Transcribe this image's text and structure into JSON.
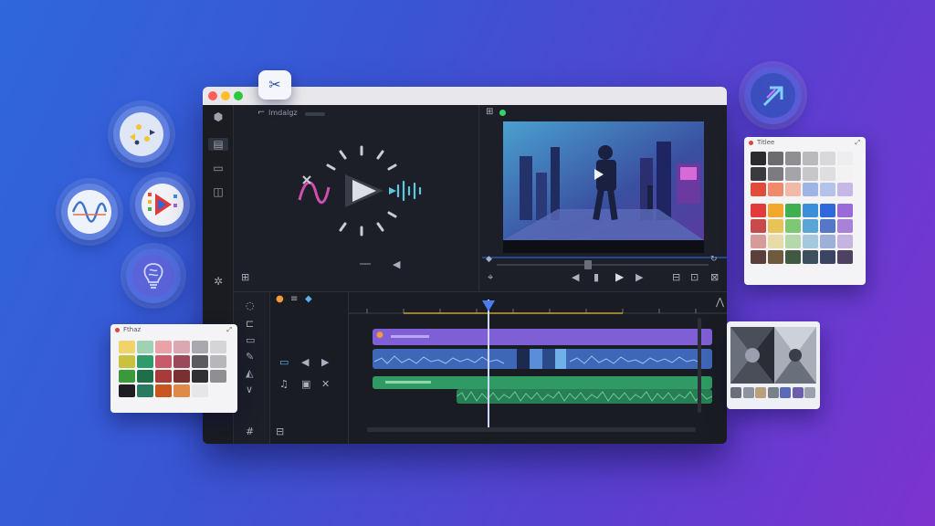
{
  "toolbar": {
    "pin_icon": "pin-icon"
  },
  "media_panel": {
    "tab_label": "Imdalgz"
  },
  "palette_right": {
    "title": "Titlee"
  },
  "palette_left": {
    "title": "Fthaz"
  },
  "colors": {
    "accent_purple": "#8a63e0",
    "accent_blue": "#3f73c8",
    "accent_green": "#3fb07a",
    "playhead": "#4a7df0",
    "status_green": "#3ad06b"
  },
  "palette_right_swatches": [
    [
      "#2b2b2e",
      "#6b6b70",
      "#8e8e93",
      "#b9b9be",
      "#d9d9dc",
      "#eeeeef"
    ],
    [
      "#3b3b3f",
      "#7c7c80",
      "#a5a5a9",
      "#c7c7ca",
      "#dedee0",
      "#f2f2f3"
    ],
    [
      "#e04b3a",
      "#f08a6c",
      "#f3b9a8",
      "#9db4e4",
      "#b3c3ea",
      "#c6b8e6"
    ],
    [
      "#e23a3a",
      "#f2a92b",
      "#3fb04d",
      "#3a8fd8",
      "#2f67dc",
      "#9a6ad8"
    ],
    [
      "#c84a4a",
      "#e8c35a",
      "#7fc873",
      "#5aa5d6",
      "#5577c8",
      "#a882d8"
    ],
    [
      "#d69a9a",
      "#e7dba8",
      "#b4d8a9",
      "#a6c8df",
      "#9fb0d8",
      "#c4b4df"
    ],
    [
      "#5a3f3b",
      "#6e5b3b",
      "#3f5a41",
      "#3c4f5e",
      "#3a4463",
      "#4e4260"
    ]
  ],
  "palette_left_swatches": [
    [
      "#f0d36a",
      "#9fd1b4",
      "#e9a2a8",
      "#d9a8b3",
      "#a8a8ae",
      "#d5d5d9"
    ],
    [
      "#c9c23e",
      "#2f9a6a",
      "#c95a6a",
      "#9a4a5a",
      "#5a5a60",
      "#b6b6bb"
    ],
    [
      "#3a9a3a",
      "#1f6e4a",
      "#a83a3a",
      "#7a3030",
      "#303034",
      "#8e8e93"
    ],
    [
      "#1e1e22",
      "#2a7a60",
      "#c9561f",
      "#e08a4a",
      "#e6e6e9",
      "#f4f4f6"
    ]
  ]
}
